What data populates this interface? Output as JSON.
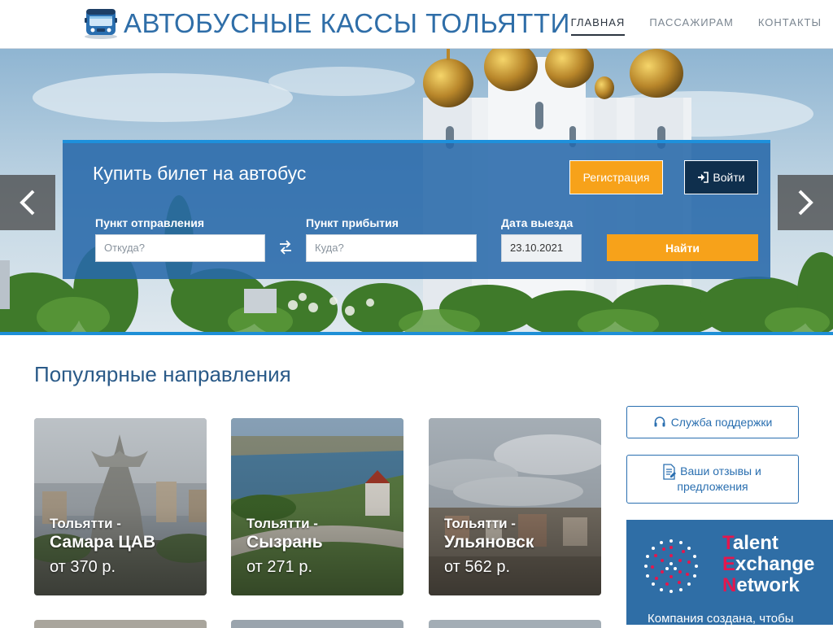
{
  "header": {
    "title": "АВТОБУСНЫЕ КАССЫ ТОЛЬЯТТИ",
    "nav": [
      {
        "label": "ГЛАВНАЯ",
        "active": true
      },
      {
        "label": "ПАССАЖИРАМ",
        "active": false
      },
      {
        "label": "КОНТАКТЫ",
        "active": false
      }
    ]
  },
  "search": {
    "title": "Купить билет на автобус",
    "register_label": "Регистрация",
    "login_label": "Войти",
    "from_label": "Пункт отправления",
    "from_placeholder": "Откуда?",
    "to_label": "Пункт прибытия",
    "to_placeholder": "Куда?",
    "date_label": "Дата выезда",
    "date_value": "23.10.2021",
    "find_label": "Найти"
  },
  "popular": {
    "title": "Популярные направления",
    "routes": [
      {
        "from": "Тольятти -",
        "to": "Самара ЦАВ",
        "price": "от 370 р."
      },
      {
        "from": "Тольятти -",
        "to": "Сызрань",
        "price": "от 271 р."
      },
      {
        "from": "Тольятти -",
        "to": "Ульяновск",
        "price": "от 562 р."
      }
    ]
  },
  "sidebar": {
    "support_label": "Служба поддержки",
    "reviews_line1": "Ваши отзывы и",
    "reviews_line2": "предложения"
  },
  "ad": {
    "line1_first": "T",
    "line1_rest": "alent",
    "line2_first": "E",
    "line2_rest": "xchange",
    "line3_first": "N",
    "line3_rest": "etwork",
    "text": "Компания создана, чтобы"
  },
  "colors": {
    "brand_blue": "#2f6ea8",
    "accent_orange": "#f7a21a",
    "dark_navy": "#0f2f4d",
    "hero_bar": "#1e8fd6"
  }
}
